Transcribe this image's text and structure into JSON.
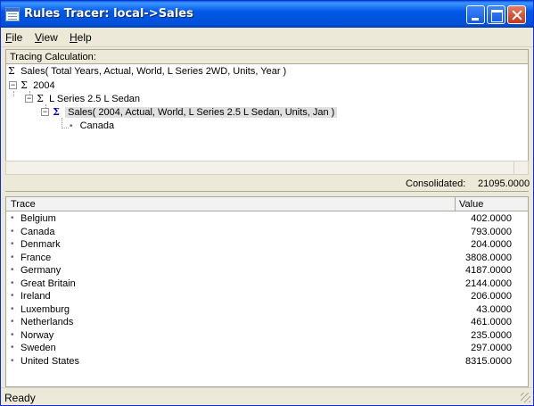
{
  "window": {
    "title": "Rules Tracer: local->Sales"
  },
  "menu": {
    "file": "File",
    "view": "View",
    "help": "Help"
  },
  "panel": {
    "label": "Tracing Calculation:"
  },
  "tree": {
    "root": "Sales( Total Years, Actual, World, L Series 2WD, Units, Year )",
    "level1": "2004",
    "level2": "L Series 2.5 L Sedan",
    "level3": "Sales( 2004, Actual, World, L Series 2.5 L Sedan, Units, Jan )",
    "level4": "Canada"
  },
  "consolidated": {
    "label": "Consolidated:",
    "value": "21095.0000"
  },
  "grid": {
    "headers": {
      "trace": "Trace",
      "value": "Value"
    },
    "rows": [
      {
        "name": "Belgium",
        "value": "402.0000"
      },
      {
        "name": "Canada",
        "value": "793.0000"
      },
      {
        "name": "Denmark",
        "value": "204.0000"
      },
      {
        "name": "France",
        "value": "3808.0000"
      },
      {
        "name": "Germany",
        "value": "4187.0000"
      },
      {
        "name": "Great Britain",
        "value": "2144.0000"
      },
      {
        "name": "Ireland",
        "value": "206.0000"
      },
      {
        "name": "Luxemburg",
        "value": "43.0000"
      },
      {
        "name": "Netherlands",
        "value": "461.0000"
      },
      {
        "name": "Norway",
        "value": "235.0000"
      },
      {
        "name": "Sweden",
        "value": "297.0000"
      },
      {
        "name": "United States",
        "value": "8315.0000"
      }
    ]
  },
  "status": {
    "text": "Ready"
  }
}
